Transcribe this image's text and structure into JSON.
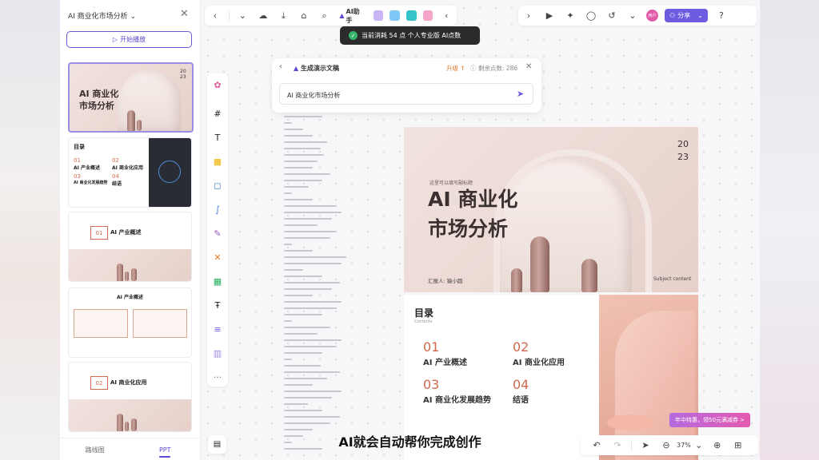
{
  "doc": {
    "title": "AI 商业化市场分析"
  },
  "left_panel": {
    "play_label": "开始播放",
    "tabs": [
      "路线图",
      "PPT"
    ],
    "thumbs": {
      "t1_title": "AI 商业化\n市场分析",
      "t1_year": "20\n23",
      "t2_heading": "目录",
      "t2_items": [
        "01",
        "AI 产业概述",
        "02",
        "AI 商业化应用",
        "03",
        "AI 商业化发展趋势",
        "04",
        "结语"
      ],
      "t3_num": "01",
      "t3_label": "AI 产业概述",
      "t4_title": "AI 产业概述",
      "t5_num": "02",
      "t5_label": "AI 商业化应用"
    }
  },
  "toolbar": {
    "ai_label": "AI助手",
    "share_label": "分享",
    "avatar": "用户"
  },
  "toast": {
    "text": "当前消耗 54 点 个人专业版 AI点数"
  },
  "generate": {
    "title": "生成演示文稿",
    "upgrade": "升级",
    "points": "剩余点数: 286",
    "input": "AI 商业化市场分析"
  },
  "slide1": {
    "tagline": "这里可以填写副标题",
    "title_line1": "AI 商业化",
    "title_line2": "市场分析",
    "year": "20\n23",
    "reporter": "汇报人: 猿小圆",
    "subject": "Subject content"
  },
  "slide2": {
    "heading": "目录",
    "sub": "Contents",
    "items": [
      {
        "num": "01",
        "label": "AI 产业概述"
      },
      {
        "num": "02",
        "label": "AI 商业化应用"
      },
      {
        "num": "03",
        "label": "AI 商业化发展趋势"
      },
      {
        "num": "04",
        "label": "结语"
      }
    ]
  },
  "zoom": {
    "level": "37%"
  },
  "promo": {
    "text": "年中特惠，领50元满减券 >"
  },
  "subtitle": {
    "text": "AI就会自动帮你完成创作"
  },
  "colors": {
    "accent": "#6d5ce0",
    "peach": "#e7d0ca",
    "orange": "#d0694e"
  }
}
